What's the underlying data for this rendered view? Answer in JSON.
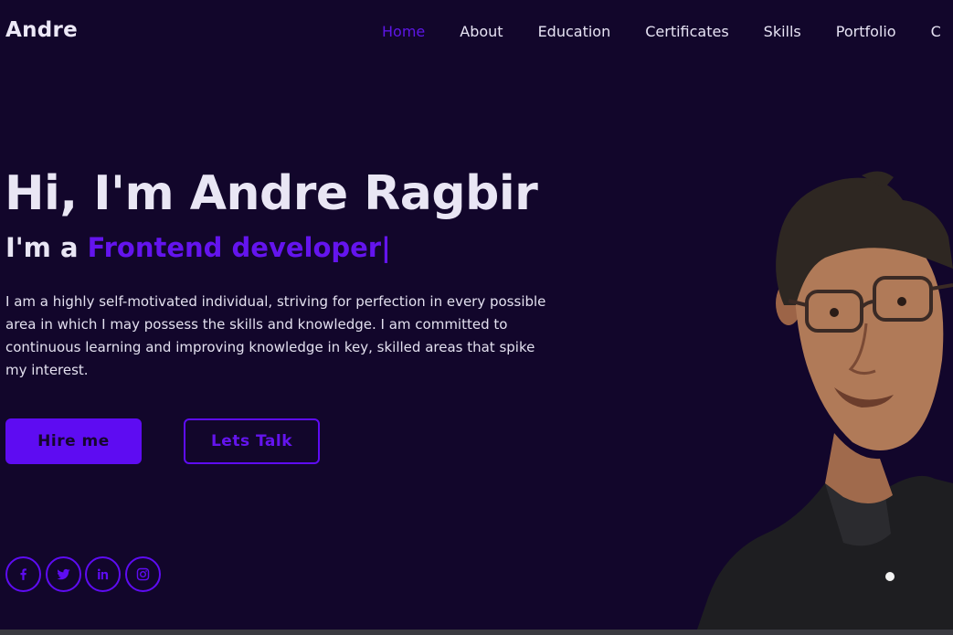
{
  "header": {
    "logo": "Andre",
    "nav": [
      {
        "label": "Home",
        "active": true
      },
      {
        "label": "About",
        "active": false
      },
      {
        "label": "Education",
        "active": false
      },
      {
        "label": "Certificates",
        "active": false
      },
      {
        "label": "Skills",
        "active": false
      },
      {
        "label": "Portfolio",
        "active": false
      },
      {
        "label": "C",
        "active": false
      }
    ]
  },
  "hero": {
    "title": "Hi, I'm Andre Ragbir",
    "subtitle_prefix": "I'm a ",
    "role": "Frontend developer",
    "caret": "|",
    "description": "I am a highly self-motivated individual, striving for perfection in every possible area in which I may possess the skills and knowledge. I am committed to continuous learning and improving knowledge in key, skilled areas that spike my interest.",
    "hire_label": "Hire me",
    "talk_label": "Lets Talk"
  },
  "social": [
    {
      "name": "facebook-icon"
    },
    {
      "name": "twitter-icon"
    },
    {
      "name": "linkedin-icon"
    },
    {
      "name": "instagram-icon"
    }
  ],
  "colors": {
    "background": "#12062b",
    "accent": "#5e0cf2",
    "text": "#e9e6f4"
  }
}
